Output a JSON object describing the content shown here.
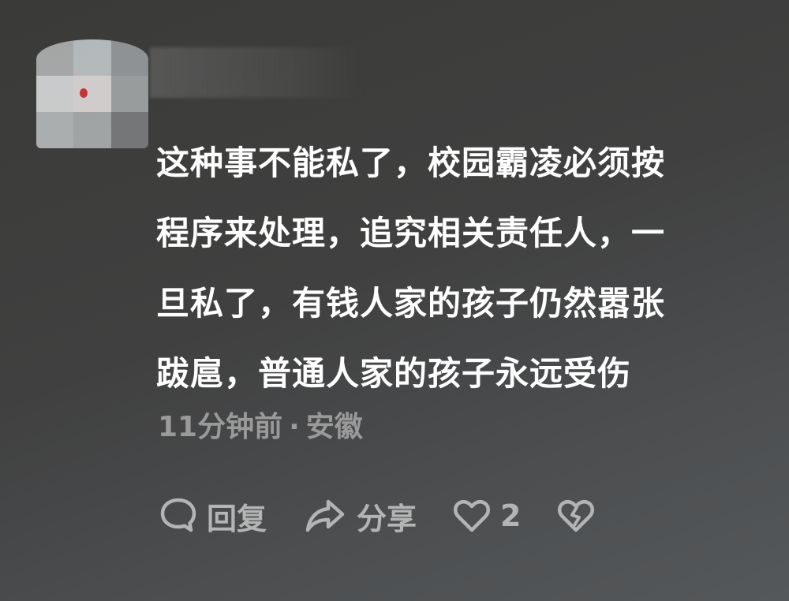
{
  "comment": {
    "text": "这种事不能私了，校园霸凌必须按\n程序来处理，追究相关责任人，一\n旦私了，有钱人家的孩子仍然嚣张\n跋扈，普通人家的孩子永远受伤",
    "time": "11分钟前",
    "separator": "·",
    "location": "安徽"
  },
  "actions": {
    "reply_label": "回复",
    "share_label": "分享",
    "like_count": "2"
  },
  "icons": {
    "reply": "speech-bubble-icon",
    "share": "share-arrow-icon",
    "like": "heart-icon",
    "dislike": "broken-heart-icon"
  },
  "colors": {
    "text": "#ffffff",
    "meta": "#9a9a9a",
    "action": "#b4b4b4"
  }
}
